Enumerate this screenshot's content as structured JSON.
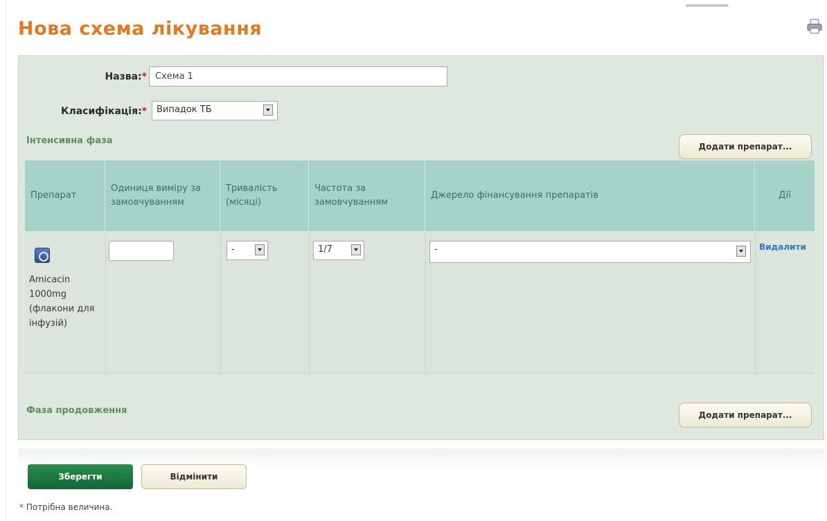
{
  "page": {
    "title": "Нова схема лікування"
  },
  "form": {
    "name_label": "Назва:",
    "name_value": "Схема 1",
    "classification_label": "Класифікація:",
    "classification_value": "Випадок ТБ",
    "required_mark": "*"
  },
  "intensive_phase": {
    "label": "Інтенсивна фаза",
    "add_button": "Додати препарат...",
    "columns": [
      "Препарат",
      "Одиниця виміру за замовчуванням",
      "Тривалість (місяці)",
      "Частота за замовчуванням",
      "Джерело фінансування препаратів",
      "Дії"
    ],
    "rows": [
      {
        "drug": "Amicacin 1000mg (флакони для інфузій)",
        "unit_value": "",
        "duration_value": "-",
        "frequency_value": "1/7",
        "funding_value": "-",
        "action": "Видалити"
      }
    ]
  },
  "continuation_phase": {
    "label": "Фаза продовження",
    "add_button": "Додати препарат..."
  },
  "footer": {
    "save_button": "Зберегти",
    "cancel_button": "Відмінити",
    "required_note": "Потрібна величина."
  },
  "icons": {
    "print": "print-icon",
    "drug": "drug-icon"
  }
}
